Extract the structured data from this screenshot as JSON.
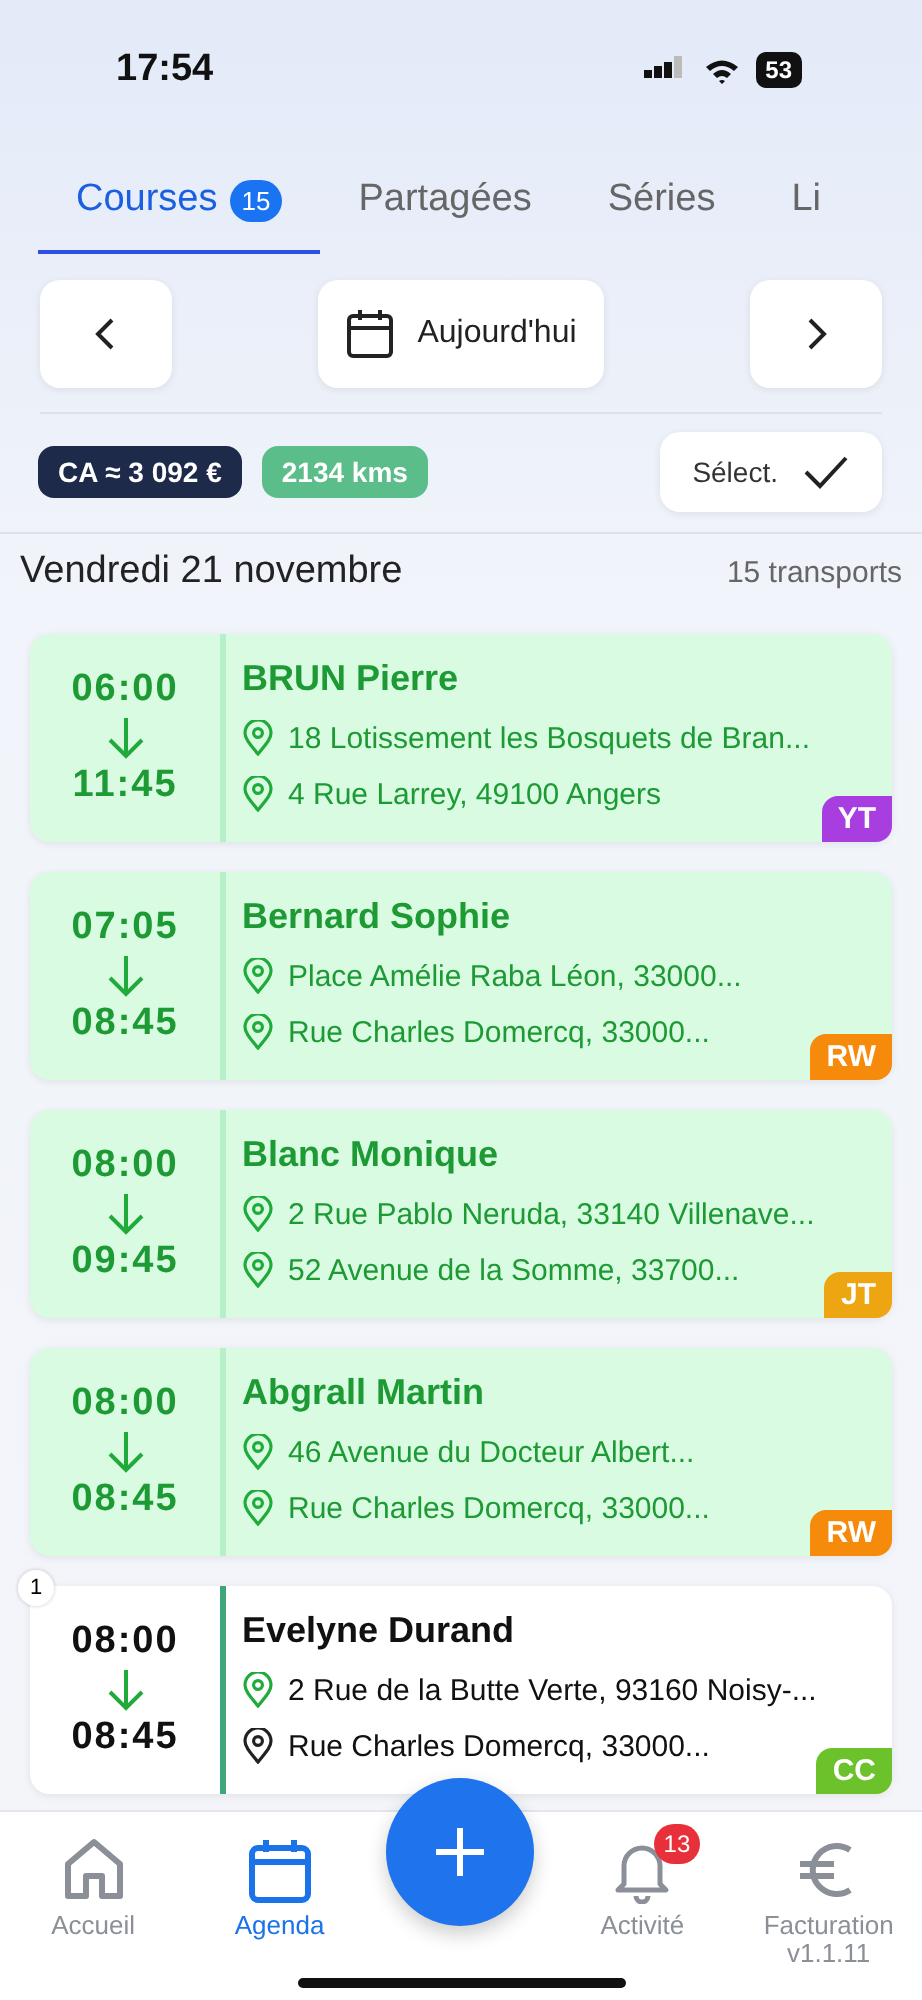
{
  "status_bar": {
    "time": "17:54",
    "battery": "53"
  },
  "tabs": [
    {
      "label": "Courses",
      "badge": "15",
      "selected": true
    },
    {
      "label": "Partagées",
      "selected": false
    },
    {
      "label": "Séries",
      "selected": false
    },
    {
      "label": "Li",
      "selected": false
    }
  ],
  "date_nav": {
    "today": "Aujourd'hui"
  },
  "summary": {
    "revenue": "CA ≈ 3 092 €",
    "distance": "2134 kms",
    "select": "Sélect."
  },
  "day": {
    "title": "Vendredi 21 novembre",
    "count": "15 transports"
  },
  "rides": [
    {
      "kind": "done",
      "start": "06:00",
      "end": "11:45",
      "patient": "BRUN Pierre",
      "from": "18 Lotissement les Bosquets de Bran...",
      "to": "4 Rue Larrey, 49100 Angers",
      "tag": "YT",
      "color": "#a93ee0"
    },
    {
      "kind": "done",
      "start": "07:05",
      "end": "08:45",
      "patient": "Bernard Sophie",
      "from": "Place Amélie Raba Léon, 33000...",
      "to": "Rue Charles Domercq, 33000...",
      "tag": "RW",
      "color": "#f58a0b"
    },
    {
      "kind": "done",
      "start": "08:00",
      "end": "09:45",
      "patient": "Blanc Monique",
      "from": "2 Rue Pablo Neruda, 33140 Villenave...",
      "to": "52 Avenue de la Somme, 33700...",
      "tag": "JT",
      "color": "#eda612"
    },
    {
      "kind": "done",
      "start": "08:00",
      "end": "08:45",
      "patient": "Abgrall Martin",
      "from": "46 Avenue du Docteur Albert...",
      "to": "Rue Charles Domercq, 33000...",
      "tag": "RW",
      "color": "#f58a0b"
    },
    {
      "kind": "planned",
      "order": "1",
      "start": "08:00",
      "end": "08:45",
      "patient": "Evelyne Durand",
      "from": "2 Rue de la Butte Verte, 93160 Noisy-...",
      "to": "Rue Charles Domercq, 33000...",
      "tag": "CC",
      "color": "#6cc22a"
    }
  ],
  "bottom_nav": [
    {
      "kind": "home",
      "label": "Accueil",
      "selected": false
    },
    {
      "kind": "calendar",
      "label": "Agenda",
      "selected": true
    },
    {
      "kind": "add"
    },
    {
      "kind": "bell",
      "label": "Activité",
      "badge": "13",
      "selected": false
    },
    {
      "kind": "euro",
      "label": "Facturation",
      "sublabel": "v1.1.11",
      "selected": false
    }
  ]
}
